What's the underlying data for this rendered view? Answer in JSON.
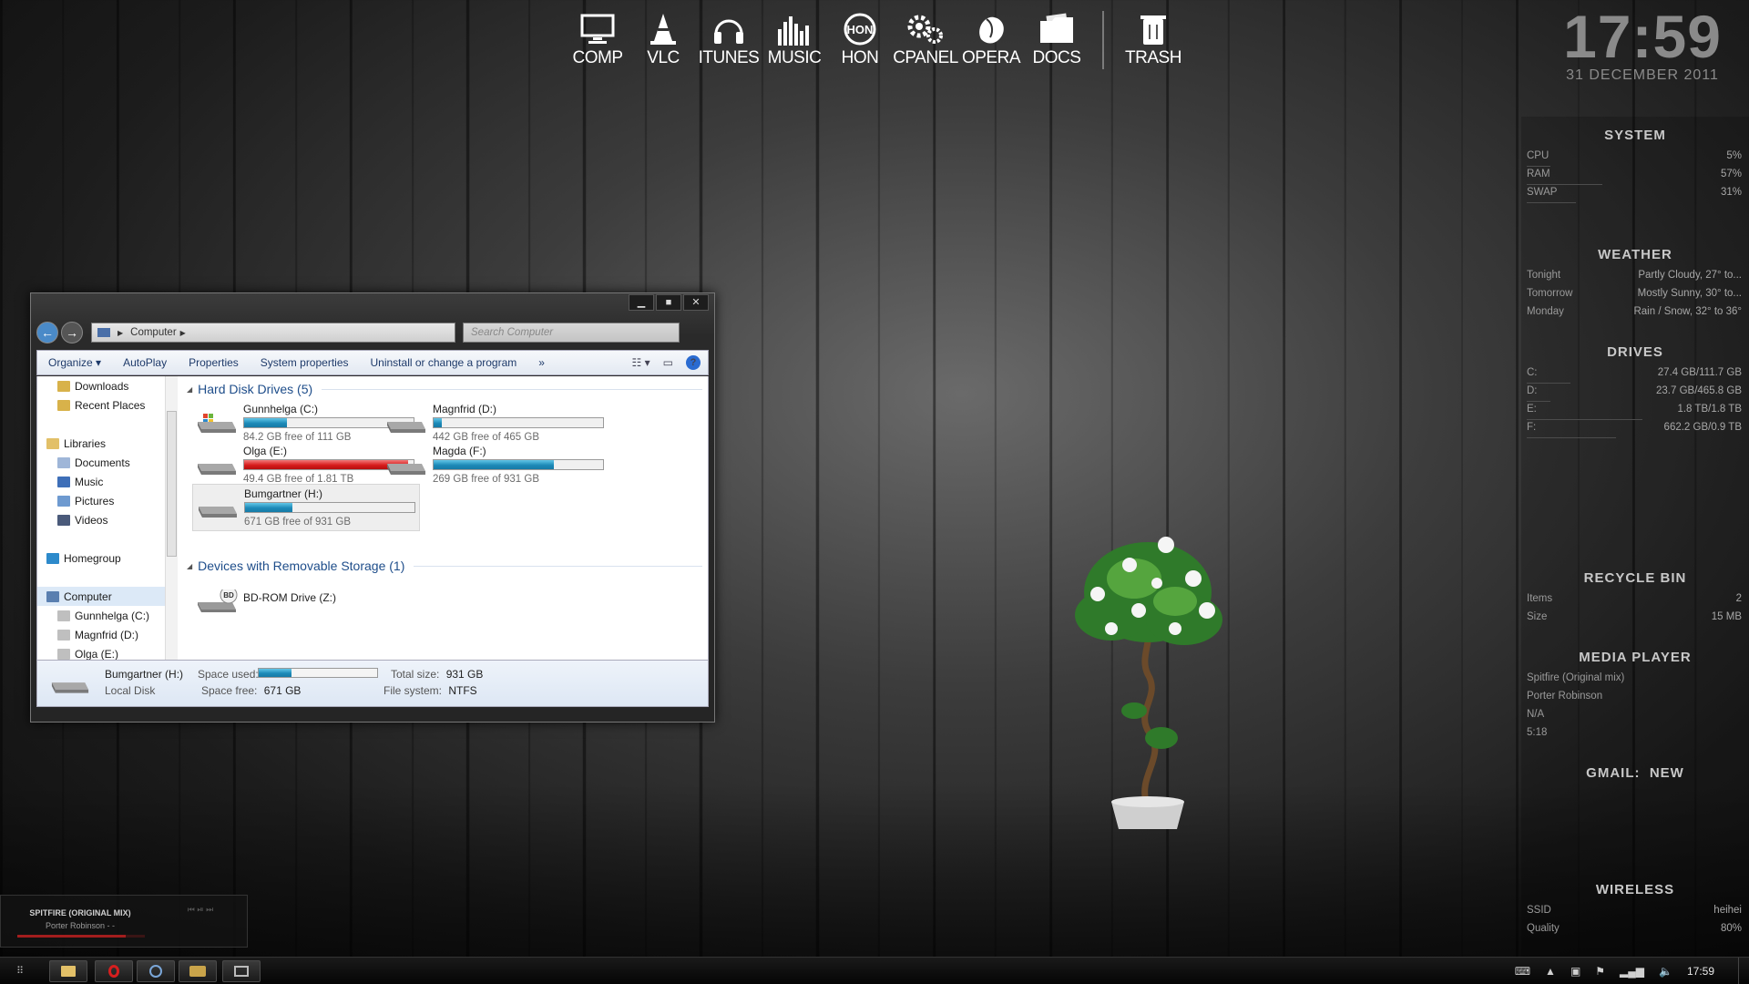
{
  "dock": {
    "items": [
      {
        "label": "COMP",
        "icon": "monitor-icon"
      },
      {
        "label": "VLC",
        "icon": "traffic-cone-icon"
      },
      {
        "label": "ITUNES",
        "icon": "headphones-icon"
      },
      {
        "label": "MUSIC",
        "icon": "equalizer-icon"
      },
      {
        "label": "HON",
        "icon": "hon-logo-icon"
      },
      {
        "label": "CPANEL",
        "icon": "gears-icon"
      },
      {
        "label": "OPERA",
        "icon": "opera-icon"
      },
      {
        "label": "DOCS",
        "icon": "folder-icon"
      }
    ],
    "trash": {
      "label": "TRASH",
      "icon": "trash-icon"
    }
  },
  "clock": {
    "time": "17:59",
    "date": "31 DECEMBER 2011"
  },
  "system": {
    "title": "SYSTEM",
    "rows": [
      {
        "k": "CPU",
        "v": "5%",
        "level": 0.05
      },
      {
        "k": "RAM",
        "v": "57%",
        "level": 0.57
      },
      {
        "k": "SWAP",
        "v": "31%",
        "level": 0.31
      }
    ]
  },
  "weather": {
    "title": "WEATHER",
    "rows": [
      {
        "k": "Tonight",
        "v": "Partly Cloudy, 27° to..."
      },
      {
        "k": "Tomorrow",
        "v": "Mostly Sunny, 30° to..."
      },
      {
        "k": "Monday",
        "v": "Rain / Snow, 32° to 36°"
      }
    ]
  },
  "drives_panel": {
    "title": "DRIVES",
    "rows": [
      {
        "k": "C:",
        "v": "27.4 GB/111.7 GB",
        "level": 0.25
      },
      {
        "k": "D:",
        "v": "23.7 GB/465.8 GB",
        "level": 0.05
      },
      {
        "k": "E:",
        "v": "1.8 TB/1.8 TB",
        "level": 0.97
      },
      {
        "k": "F:",
        "v": "662.2 GB/0.9 TB",
        "level": 0.71
      }
    ]
  },
  "recycle": {
    "title": "RECYCLE BIN",
    "rows": [
      {
        "k": "Items",
        "v": "2"
      },
      {
        "k": "Size",
        "v": "15 MB"
      }
    ]
  },
  "media": {
    "title": "MEDIA PLAYER",
    "lines": [
      "Spitfire (Original mix)",
      "Porter Robinson",
      "N/A",
      "5:18"
    ]
  },
  "gmail": {
    "title": "GMAIL:",
    "status": "NEW"
  },
  "wireless": {
    "title": "WIRELESS",
    "rows": [
      {
        "k": "SSID",
        "v": "heihei"
      },
      {
        "k": "Quality",
        "v": "80%"
      }
    ]
  },
  "explorer": {
    "address": "Computer",
    "search_placeholder": "Search Computer",
    "toolbar": {
      "organize": "Organize",
      "autoplay": "AutoPlay",
      "properties": "Properties",
      "system_properties": "System properties",
      "uninstall": "Uninstall or change a program",
      "more": "»"
    },
    "nav": [
      {
        "label": "Downloads",
        "indent": 1,
        "color": "#d8b24a"
      },
      {
        "label": "Recent Places",
        "indent": 1,
        "color": "#d8b24a"
      },
      {
        "label": "",
        "indent": 0,
        "color": ""
      },
      {
        "label": "Libraries",
        "indent": 0,
        "color": "#e2c068"
      },
      {
        "label": "Documents",
        "indent": 1,
        "color": "#9fb6d8"
      },
      {
        "label": "Music",
        "indent": 1,
        "color": "#3e6fb8"
      },
      {
        "label": "Pictures",
        "indent": 1,
        "color": "#6e9ad0"
      },
      {
        "label": "Videos",
        "indent": 1,
        "color": "#4a5a7a"
      },
      {
        "label": "",
        "indent": 0,
        "color": ""
      },
      {
        "label": "Homegroup",
        "indent": 0,
        "color": "#2d8acb"
      },
      {
        "label": "",
        "indent": 0,
        "color": ""
      },
      {
        "label": "Computer",
        "indent": 0,
        "color": "#5a7fb0",
        "selected": true
      },
      {
        "label": "Gunnhelga (C:)",
        "indent": 1,
        "color": "#bfbfbf"
      },
      {
        "label": "Magnfrid (D:)",
        "indent": 1,
        "color": "#bfbfbf"
      },
      {
        "label": "Olga (E:)",
        "indent": 1,
        "color": "#bfbfbf"
      }
    ],
    "hdd_group": "Hard Disk Drives (5)",
    "removable_group": "Devices with Removable Storage (1)",
    "drives": [
      {
        "name": "Gunnhelga (C:)",
        "free": "84.2 GB free of 111 GB",
        "used": 0.25,
        "red": false
      },
      {
        "name": "Magnfrid (D:)",
        "free": "442 GB free of 465 GB",
        "used": 0.05,
        "red": false
      },
      {
        "name": "Olga (E:)",
        "free": "49.4 GB free of 1.81 TB",
        "used": 0.97,
        "red": true
      },
      {
        "name": "Magda (F:)",
        "free": "269 GB free of 931 GB",
        "used": 0.71,
        "red": false
      },
      {
        "name": "Bumgartner (H:)",
        "free": "671 GB free of 931 GB",
        "used": 0.28,
        "red": false,
        "selected": true
      }
    ],
    "bd": {
      "name": "BD-ROM Drive (Z:)",
      "badge": "BD"
    },
    "details": {
      "name": "Bumgartner (H:)",
      "type": "Local Disk",
      "space_used_label": "Space used:",
      "space_used_level": 0.28,
      "space_free_label": "Space free:",
      "space_free": "671 GB",
      "total_label": "Total size:",
      "total": "931 GB",
      "fs_label": "File system:",
      "fs": "NTFS"
    }
  },
  "mini_player": {
    "title": "SPITFIRE (ORIGINAL MIX)",
    "artist": "Porter Robinson - -",
    "progress": 0.85
  },
  "taskbar": {
    "clock": "17:59"
  }
}
